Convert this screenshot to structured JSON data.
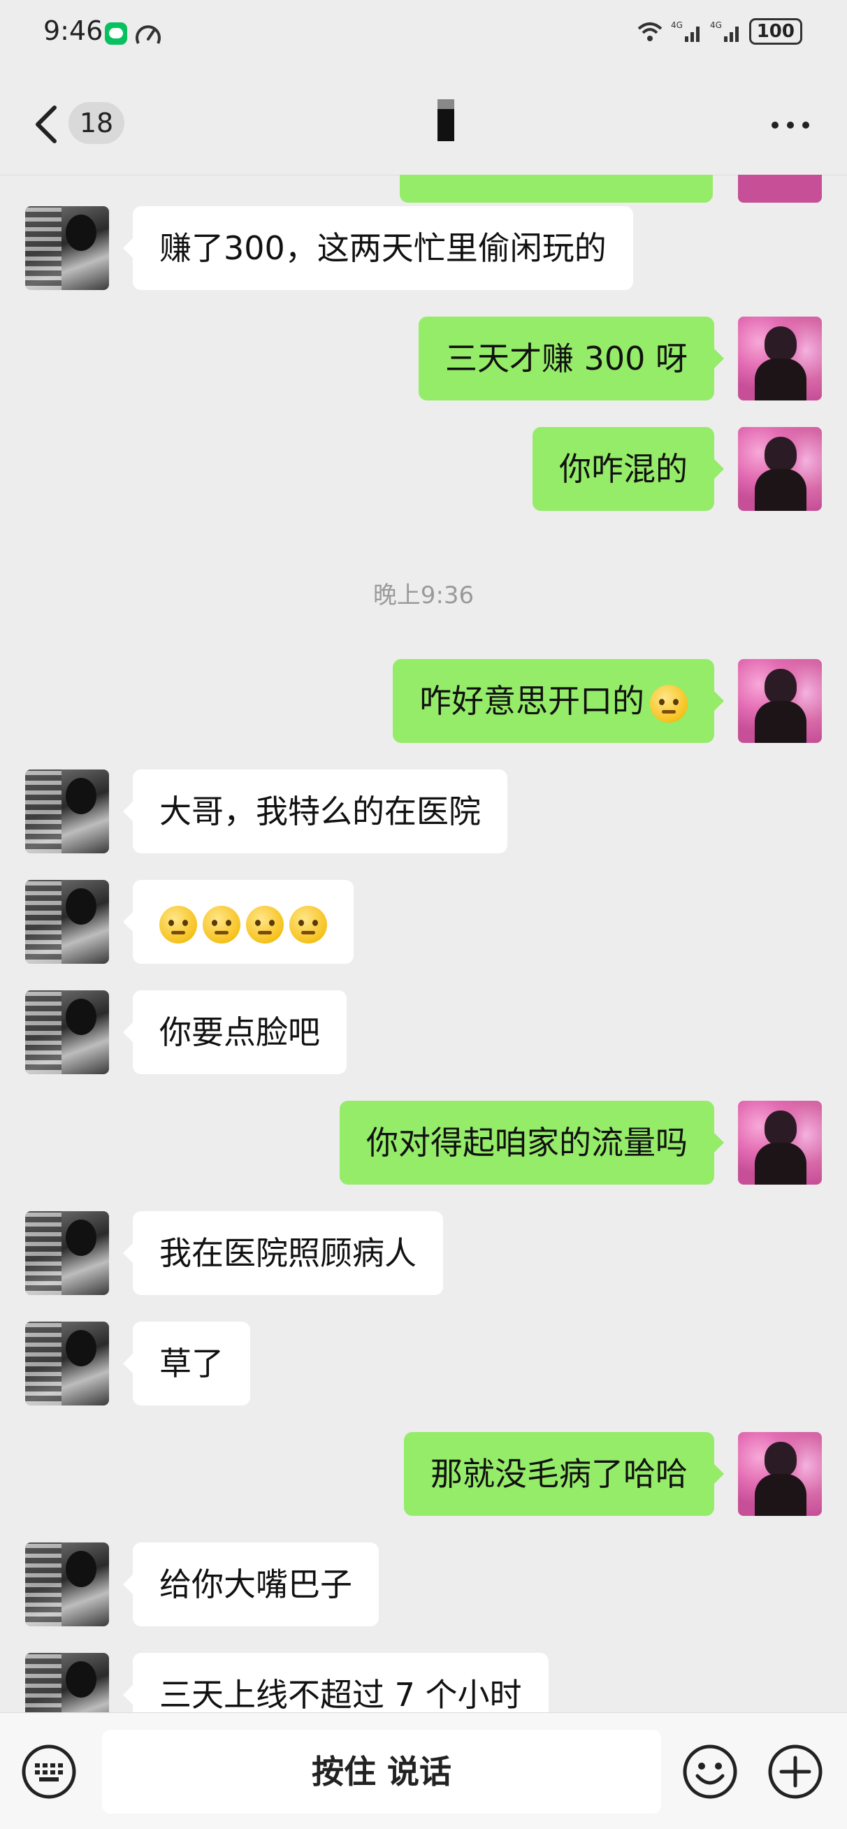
{
  "status_bar": {
    "time": "9:46",
    "network_1": "4G",
    "network_2": "4G",
    "battery": "100"
  },
  "nav": {
    "unread_count": "18",
    "title": ""
  },
  "messages": [
    {
      "side": "in",
      "text": "赚了300，这两天忙里偷闲玩的"
    },
    {
      "side": "out",
      "text": "三天才赚 300 呀"
    },
    {
      "side": "out",
      "text": "你咋混的"
    },
    {
      "side": "out",
      "text": "咋好意思开口的",
      "emoji": "sweat-face-emoji"
    },
    {
      "side": "in",
      "text": "大哥，我特么的在医院"
    },
    {
      "side": "in",
      "text": "",
      "emoji_count": 4,
      "emoji": "smiling-face-emoji"
    },
    {
      "side": "in",
      "text": "你要点脸吧"
    },
    {
      "side": "out",
      "text": "你对得起咱家的流量吗"
    },
    {
      "side": "in",
      "text": "我在医院照顾病人"
    },
    {
      "side": "in",
      "text": "草了"
    },
    {
      "side": "out",
      "text": "那就没毛病了哈哈"
    },
    {
      "side": "in",
      "text": "给你大嘴巴子"
    },
    {
      "side": "in",
      "text": "三天上线不超过 7 个小时"
    }
  ],
  "timestamp": "晚上9:36",
  "input_bar": {
    "talk_label": "按住 说话"
  },
  "colors": {
    "background": "#ededed",
    "outgoing_bubble": "#95ec69",
    "incoming_bubble": "#ffffff",
    "accent": "#07c160"
  }
}
